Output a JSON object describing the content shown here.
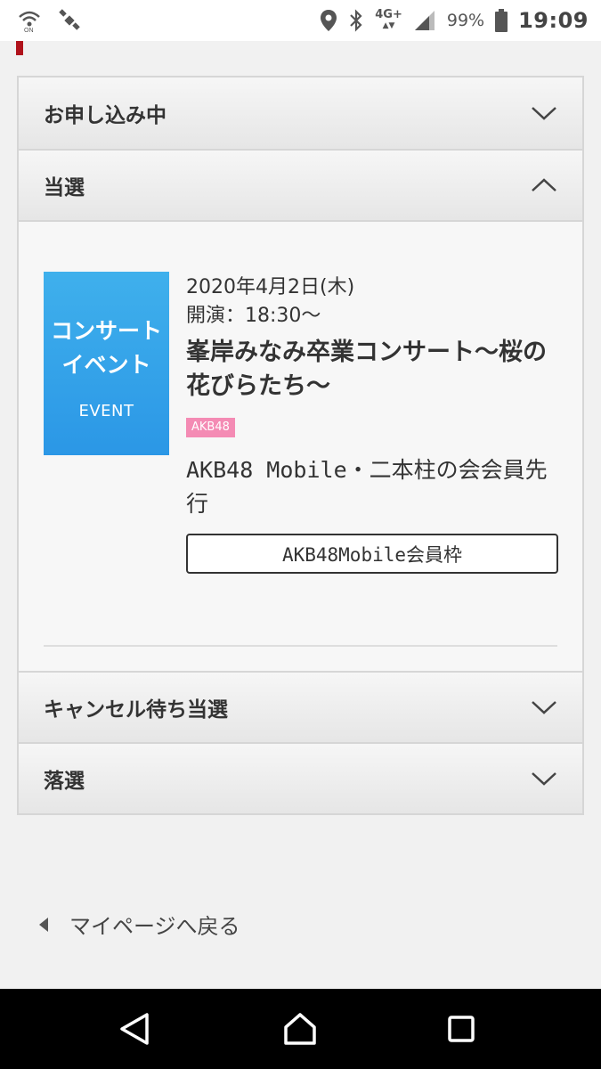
{
  "status_bar": {
    "network_label_top": "4G+",
    "network_label_bottom": "▲▼",
    "battery_percent": "99%",
    "time": "19:09"
  },
  "accordion": {
    "sections": [
      {
        "title": "お申し込み中",
        "expanded": false
      },
      {
        "title": "当選",
        "expanded": true
      },
      {
        "title": "キャンセル待ち当選",
        "expanded": false
      },
      {
        "title": "落選",
        "expanded": false
      }
    ]
  },
  "event": {
    "thumb_line1": "コンサート",
    "thumb_line2": "イベント",
    "thumb_event": "EVENT",
    "date": "2020年4月2日(木)",
    "time": "開演：18:30〜",
    "title": "峯岸みなみ卒業コンサート〜桜の花びらたち〜",
    "badge": "AKB48",
    "name": "AKB48 Mobile・二本柱の会会員先行",
    "tag": "AKB48Mobile会員枠"
  },
  "back_link": {
    "label": "マイページへ戻る"
  },
  "colors": {
    "accent_red": "#b0121b",
    "thumb_blue": "#3fb0ec",
    "badge_pink": "#f48bb4"
  }
}
